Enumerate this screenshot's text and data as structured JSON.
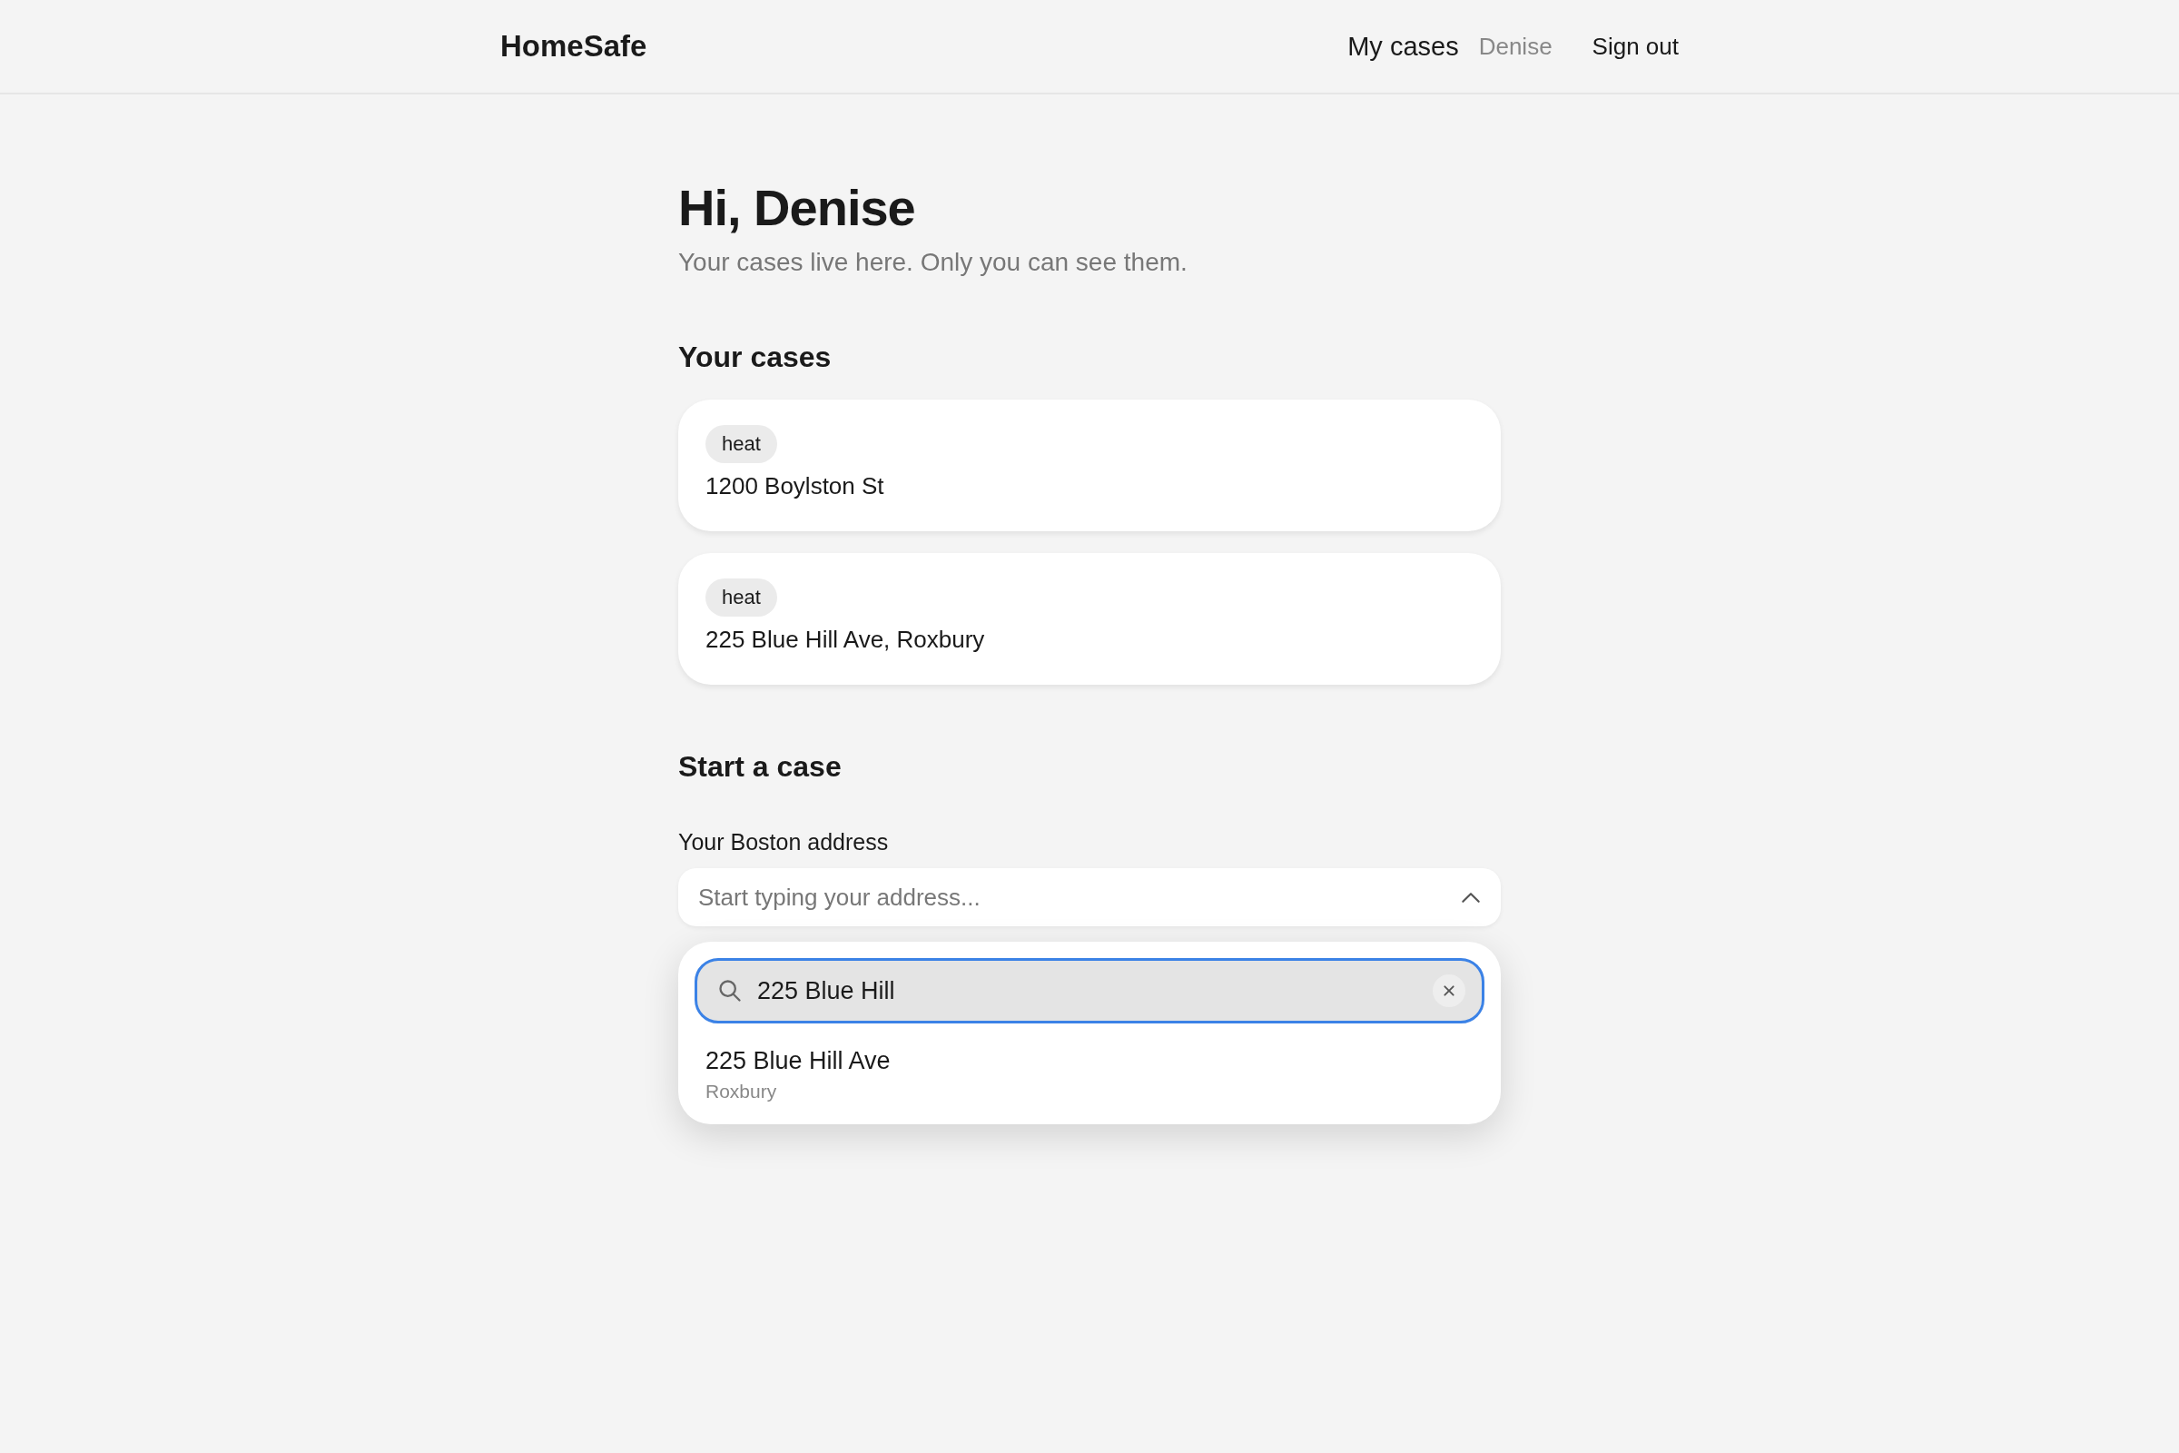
{
  "header": {
    "logo": "HomeSafe",
    "nav": [
      {
        "label": "My cases",
        "kind": "link"
      },
      {
        "label": "Denise",
        "kind": "user"
      },
      {
        "label": "Sign out",
        "kind": "button"
      }
    ]
  },
  "greeting": {
    "title": "Hi, Denise",
    "subtitle": "Your cases live here. Only you can see them."
  },
  "cases_section": {
    "heading": "Your cases",
    "cases": [
      {
        "tag": "heat",
        "address": "1200 Boylston St"
      },
      {
        "tag": "heat",
        "address": "225 Blue Hill Ave, Roxbury"
      }
    ]
  },
  "start_section": {
    "heading": "Start a case",
    "field_label": "Your Boston address",
    "select": {
      "placeholder": "Start typing your address...",
      "expanded": true
    },
    "dropdown": {
      "search_value": "225 Blue Hill",
      "results": [
        {
          "title": "225 Blue Hill Ave",
          "subtitle": "Roxbury"
        }
      ]
    }
  }
}
